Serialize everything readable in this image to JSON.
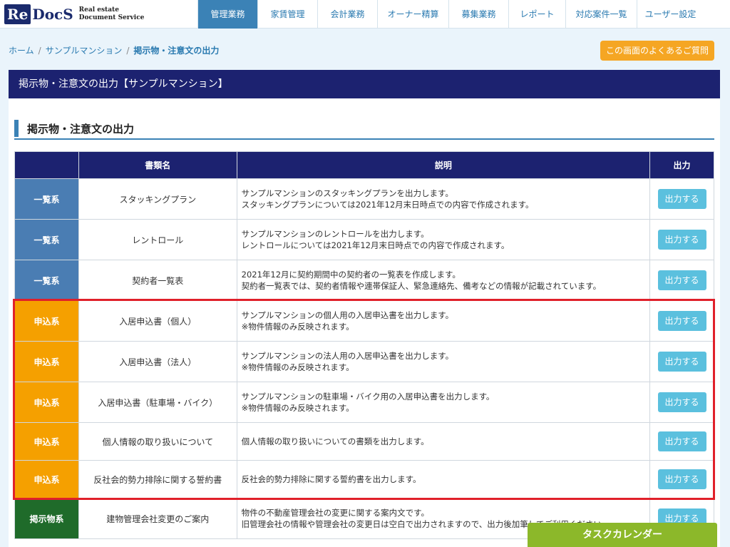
{
  "logo": {
    "re": "Re",
    "docs": "DocS",
    "sub_line1": "Real estate",
    "sub_line2": "Document Service"
  },
  "nav": [
    {
      "label": "管理業務",
      "active": true
    },
    {
      "label": "家賃管理"
    },
    {
      "label": "会計業務"
    },
    {
      "label": "オーナー精算"
    },
    {
      "label": "募集業務"
    },
    {
      "label": "レポート"
    },
    {
      "label": "対応案件一覧"
    },
    {
      "label": "ユーザー設定"
    }
  ],
  "breadcrumb": {
    "home": "ホーム",
    "sep": "/",
    "property": "サンプルマンション",
    "current": "掲示物・注意文の出力"
  },
  "faq_button": "この画面のよくあるご質問",
  "panel_title": "掲示物・注意文の出力【サンプルマンション】",
  "section_title": "掲示物・注意文の出力",
  "table": {
    "headers": [
      "",
      "書類名",
      "説明",
      "出力"
    ],
    "output_label": "出力する",
    "rows": [
      {
        "category": "一覧系",
        "type": "list",
        "name": "スタッキングプラン",
        "desc1": "サンプルマンションのスタッキングプランを出力します。",
        "desc2": "スタッキングプランについては2021年12月末日時点での内容で作成されます。"
      },
      {
        "category": "一覧系",
        "type": "list",
        "name": "レントロール",
        "desc1": "サンプルマンションのレントロールを出力します。",
        "desc2": "レントロールについては2021年12月末日時点での内容で作成されます。"
      },
      {
        "category": "一覧系",
        "type": "list",
        "name": "契約者一覧表",
        "desc1": "2021年12月に契約期間中の契約者の一覧表を作成します。",
        "desc2": "契約者一覧表では、契約者情報や連帯保証人、緊急連絡先、備考などの情報が記載されています。"
      },
      {
        "category": "申込系",
        "type": "apply",
        "name": "入居申込書（個人）",
        "desc1": "サンプルマンションの個人用の入居申込書を出力します。",
        "desc2": "※物件情報のみ反映されます。"
      },
      {
        "category": "申込系",
        "type": "apply",
        "name": "入居申込書（法人）",
        "desc1": "サンプルマンションの法人用の入居申込書を出力します。",
        "desc2": "※物件情報のみ反映されます。"
      },
      {
        "category": "申込系",
        "type": "apply",
        "name": "入居申込書（駐車場・バイク）",
        "desc1": "サンプルマンションの駐車場・バイク用の入居申込書を出力します。",
        "desc2": "※物件情報のみ反映されます。"
      },
      {
        "category": "申込系",
        "type": "apply",
        "name": "個人情報の取り扱いについて",
        "desc1": "個人情報の取り扱いについての書類を出力します。",
        "desc2": ""
      },
      {
        "category": "申込系",
        "type": "apply",
        "name": "反社会的勢力排除に関する誓約書",
        "desc1": "反社会的勢力排除に関する誓約書を出力します。",
        "desc2": ""
      },
      {
        "category": "掲示物系",
        "type": "notice",
        "name": "建物管理会社変更のご案内",
        "desc1": "物件の不動産管理会社の変更に関する案内文です。",
        "desc2": "旧管理会社の情報や管理会社の変更日は空白で出力されますので、出力後加筆してご利用ください。"
      }
    ]
  },
  "task_calendar": "タスクカレンダー"
}
